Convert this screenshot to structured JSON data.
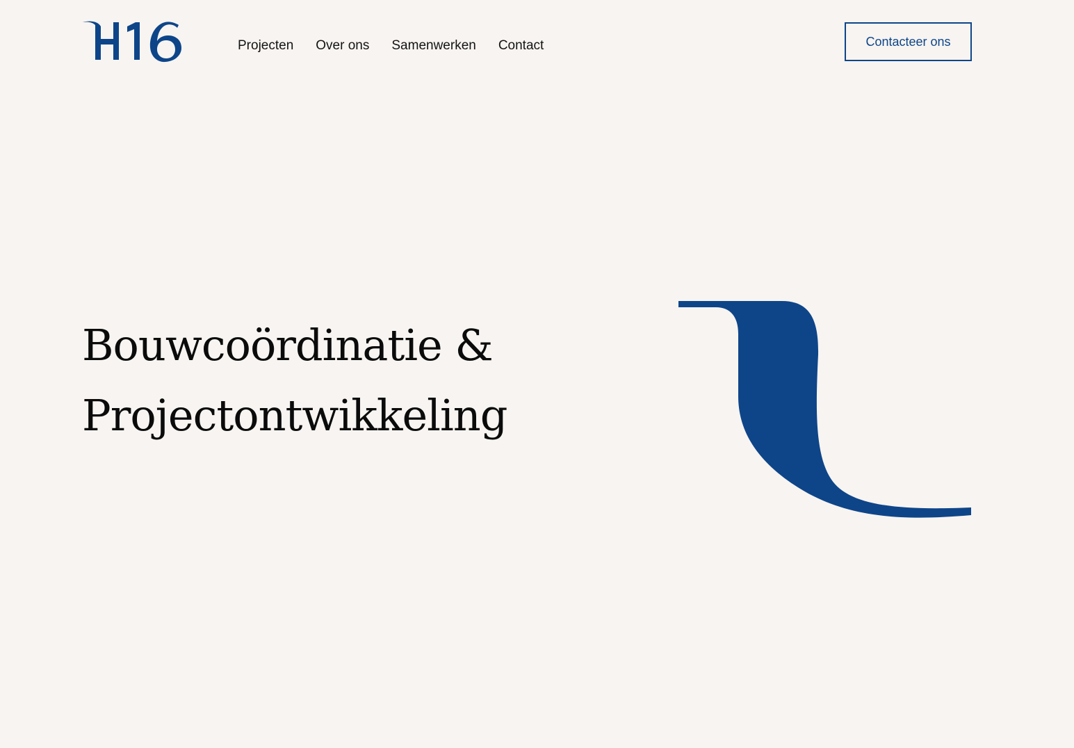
{
  "logo": {
    "text": "H16",
    "alt": "H16"
  },
  "nav": {
    "items": [
      {
        "label": "Projecten"
      },
      {
        "label": "Over ons"
      },
      {
        "label": "Samenwerken"
      },
      {
        "label": "Contact"
      }
    ]
  },
  "cta": {
    "label": "Contacteer ons"
  },
  "hero": {
    "title_line1": "Bouwcoördinatie &",
    "title_line2": "Projectontwikkeling"
  },
  "colors": {
    "brand": "#0e4589",
    "background": "#f7f4f1",
    "text": "#0b0b0b"
  }
}
